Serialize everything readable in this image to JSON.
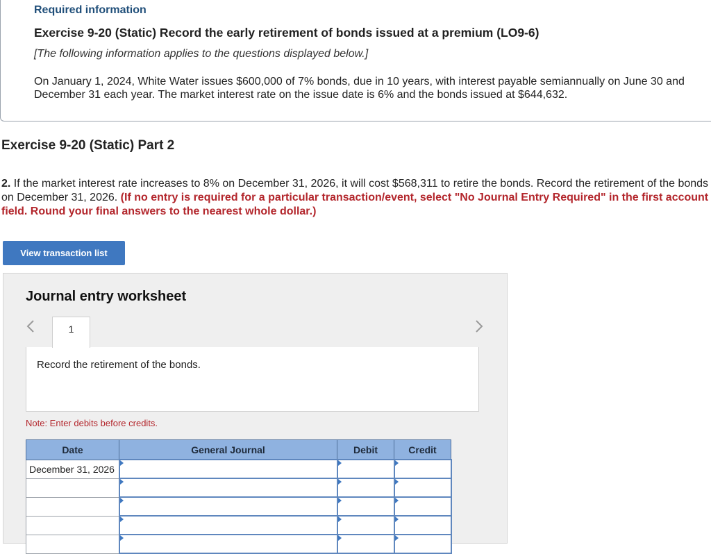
{
  "info": {
    "heading": "Required information",
    "title": "Exercise 9-20 (Static) Record the early retirement of bonds issued at a premium (LO9-6)",
    "note": "[The following information applies to the questions displayed below.]",
    "body": "On January 1, 2024, White Water issues $600,000 of 7% bonds, due in 10 years, with interest payable semiannually on June 30 and December 31 each year. The market interest rate on the issue date is 6% and the bonds issued at $644,632."
  },
  "part": {
    "title": "Exercise 9-20 (Static) Part 2"
  },
  "question": {
    "number": "2.",
    "text": " If the market interest rate increases to 8% on December 31, 2026, it will cost $568,311 to retire the bonds. Record the retirement of the bonds on December 31, 2026. ",
    "instruction": "(If no entry is required for a particular transaction/event, select \"No Journal Entry Required\" in the first account field. Round your final answers to the nearest whole dollar.)"
  },
  "view_button": {
    "label": "View transaction list"
  },
  "worksheet": {
    "title": "Journal entry worksheet",
    "nav_prev_icon": "chevron-left-icon",
    "nav_next_icon": "chevron-right-icon",
    "tab_label": "1",
    "description": "Record the retirement of the bonds.",
    "note": "Note: Enter debits before credits.",
    "columns": {
      "date": "Date",
      "journal": "General Journal",
      "debit": "Debit",
      "credit": "Credit"
    },
    "rows": [
      {
        "date": "December 31, 2026"
      },
      {
        "date": ""
      },
      {
        "date": ""
      },
      {
        "date": ""
      },
      {
        "date": ""
      }
    ]
  },
  "colors": {
    "accent": "#3f78c0",
    "heading_blue": "#1f4e79",
    "instruction_red": "#b3262c",
    "table_header": "#8fb2e0"
  }
}
